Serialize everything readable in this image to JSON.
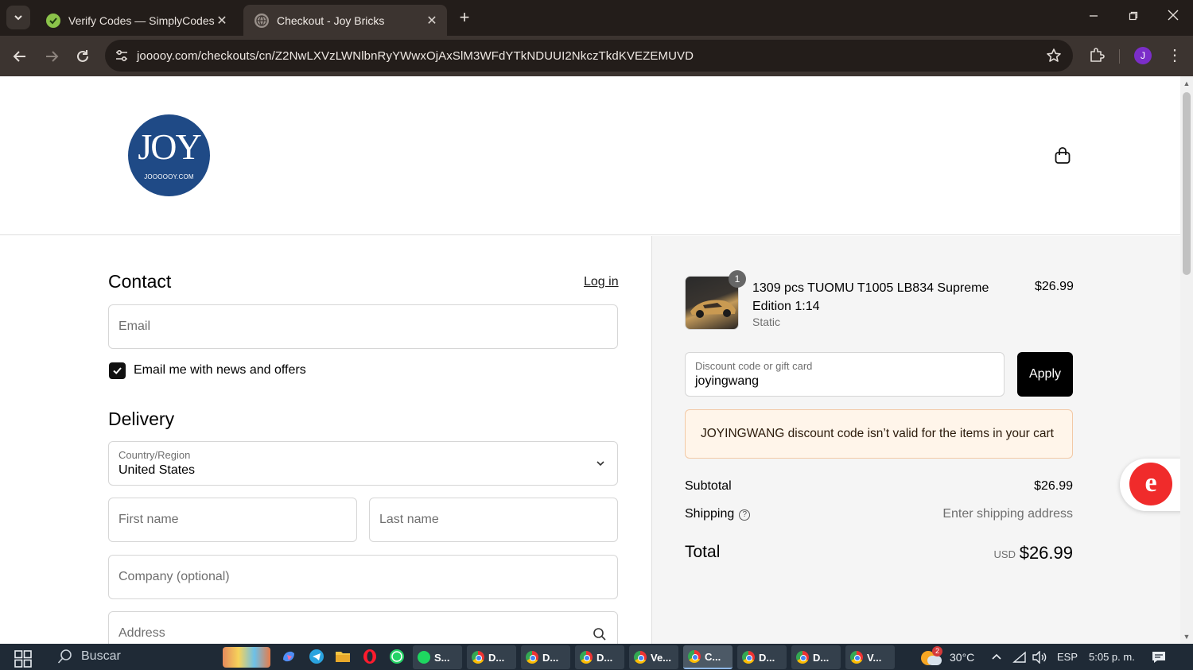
{
  "browser": {
    "tabs": [
      {
        "title": "Verify Codes — SimplyCodes",
        "active": false
      },
      {
        "title": "Checkout - Joy Bricks",
        "active": true
      }
    ],
    "url": "jooooy.com/checkouts/cn/Z2NwLXVzLWNlbnRyYWwxOjAxSlM3WFdYTkNDUUI2NkczTkdKVEZEMUVD",
    "profile_initial": "J"
  },
  "header": {
    "logo_text": "JOY",
    "logo_subtext": "JOOOOOY.COM"
  },
  "contact": {
    "heading": "Contact",
    "login_link": "Log in",
    "email_placeholder": "Email",
    "newsletter_label": "Email me with news and offers",
    "newsletter_checked": true
  },
  "delivery": {
    "heading": "Delivery",
    "country_label": "Country/Region",
    "country_value": "United States",
    "first_name_placeholder": "First name",
    "last_name_placeholder": "Last name",
    "company_placeholder": "Company (optional)",
    "address_placeholder": "Address"
  },
  "summary": {
    "item": {
      "quantity": "1",
      "name": "1309 pcs TUOMU T1005 LB834 Supreme Edition 1:14",
      "variant": "Static",
      "price": "$26.99"
    },
    "discount_label": "Discount code or gift card",
    "discount_value": "joyingwang",
    "apply_label": "Apply",
    "error_message": "JOYINGWANG discount code isn’t valid for the items in your cart",
    "subtotal_label": "Subtotal",
    "subtotal_value": "$26.99",
    "shipping_label": "Shipping",
    "shipping_value": "Enter shipping address",
    "total_label": "Total",
    "total_currency": "USD",
    "total_value": "$26.99"
  },
  "taskbar": {
    "search_label": "Buscar",
    "apps": [
      "S...",
      "D...",
      "D...",
      "D...",
      "Ve...",
      "C...",
      "D...",
      "D...",
      "V..."
    ],
    "weather_badge": "2",
    "temperature": "30°C",
    "language": "ESP",
    "time": "5:05 p. m."
  },
  "colors": {
    "tab_bg": "#231d1a",
    "toolbar_bg": "#3c3430",
    "logo_bg": "#1f4a86",
    "warning_bg": "#fff5ea",
    "warning_border": "#f2c9a6",
    "apply_bg": "#000000",
    "summary_bg": "#f5f5f5",
    "widget_red": "#f02b2b"
  }
}
